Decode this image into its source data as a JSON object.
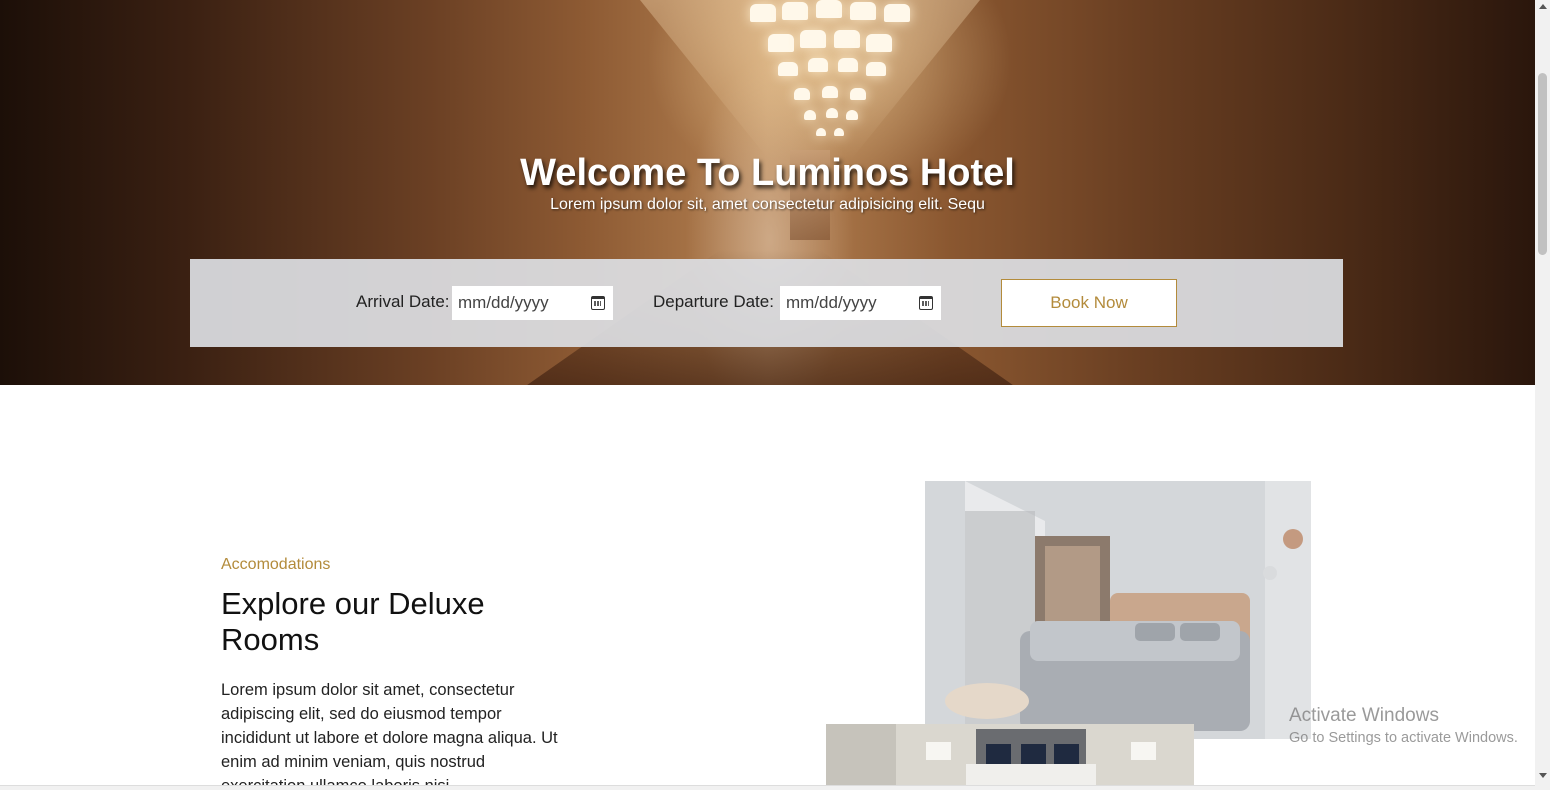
{
  "hero": {
    "title": "Welcome To Luminos Hotel",
    "subtitle": "Lorem ipsum dolor sit, amet consectetur adipisicing elit. Sequ"
  },
  "booking": {
    "arrival_label": "Arrival Date:",
    "arrival_placeholder": "mm/dd/yyyy",
    "departure_label": "Departure Date:",
    "departure_placeholder": "mm/dd/yyyy",
    "button_label": "Book Now"
  },
  "accommodations": {
    "eyebrow": "Accomodations",
    "title": "Explore our Deluxe Rooms",
    "body": "Lorem ipsum dolor sit amet, consectetur adipiscing elit, sed do eiusmod tempor incididunt ut labore et dolore magna aliqua. Ut enim ad minim veniam, quis nostrud exercitation ullamco laboris nisi"
  },
  "watermark": {
    "line1": "Activate Windows",
    "line2": "Go to Settings to activate Windows."
  },
  "colors": {
    "accent": "#b38b3b",
    "booking_bar": "#dcdee2"
  }
}
